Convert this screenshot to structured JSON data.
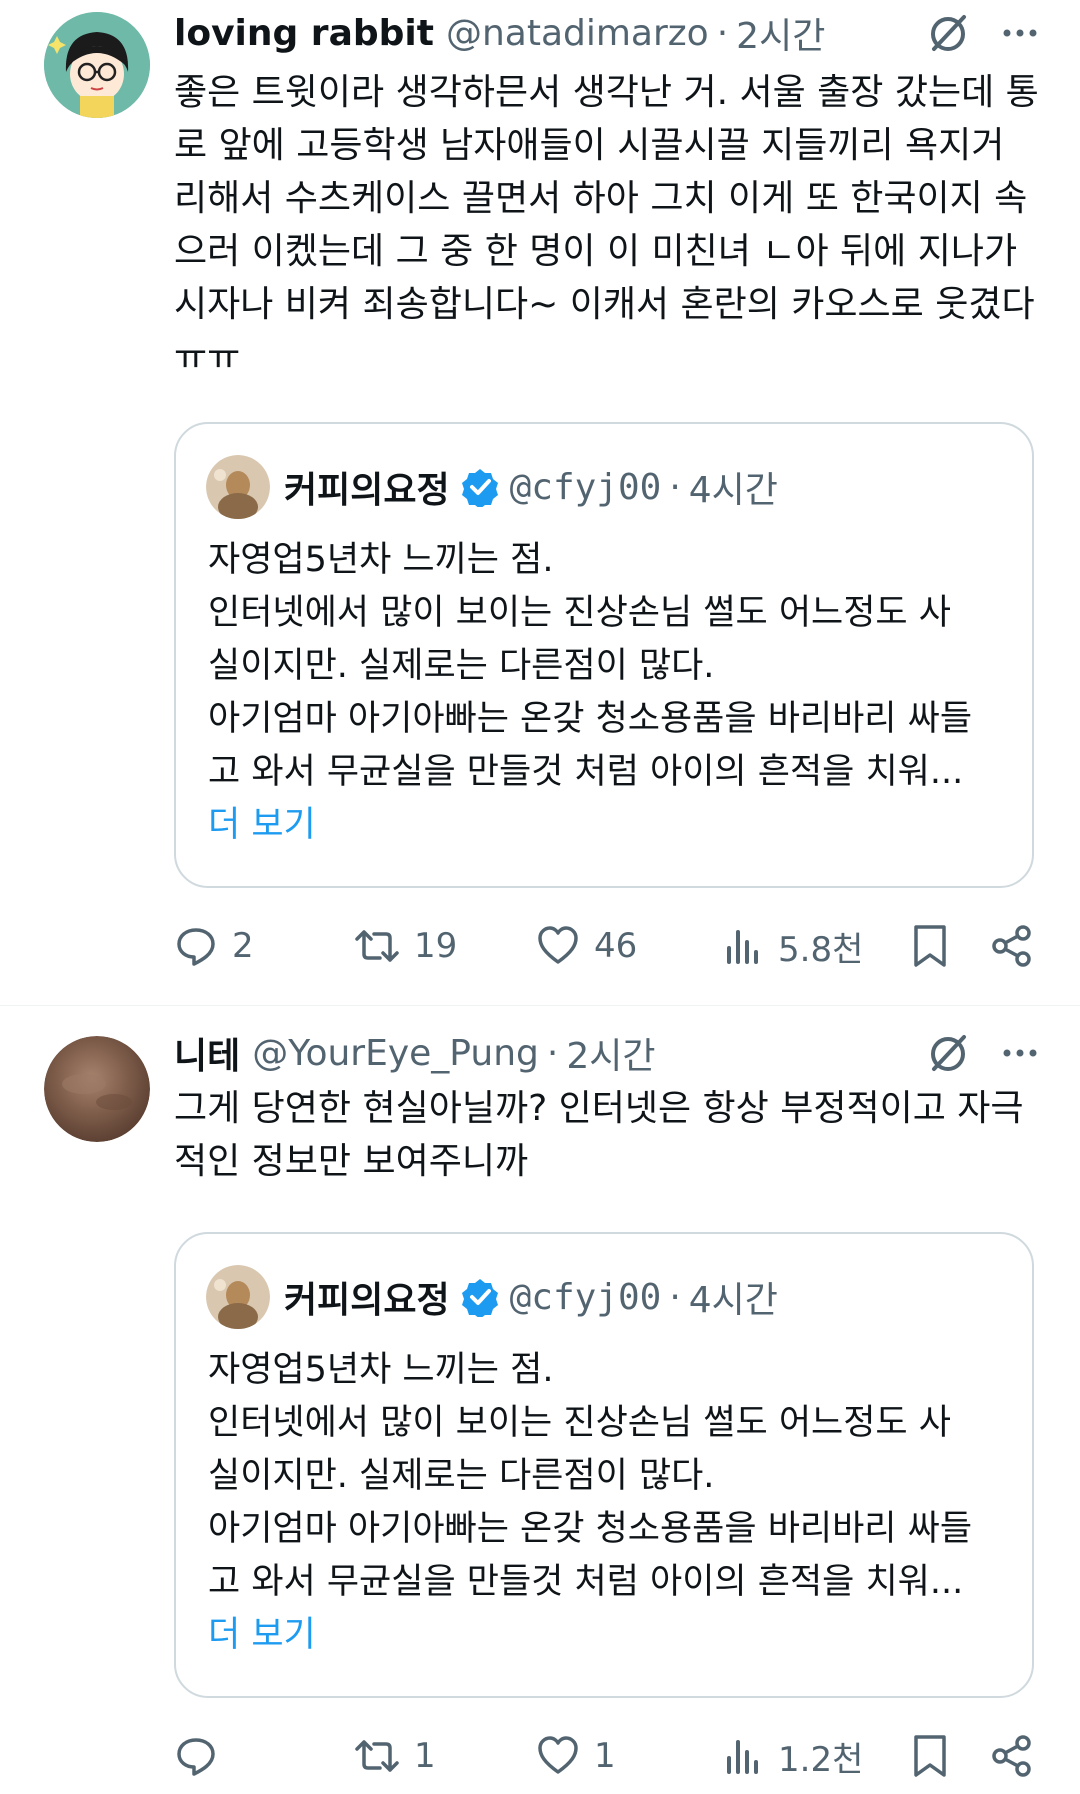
{
  "tweets": [
    {
      "name": "loving rabbit",
      "handle": "@natadimarzo",
      "separator": "·",
      "time": "2시간",
      "lines": [
        "좋은 트윗이라 생각하믄서 생각난 거. 서울 출장 갔는데 통",
        "로 앞에 고등학생 남자애들이 시끌시끌 지들끼리 욕지거",
        "리해서 수츠케이스 끌면서 하아 그치 이게 또 한국이지 속",
        "으러 이켔는데 그 중 한 명이 이 미친녀 ㄴ아  뒤에 지나가",
        "시자나 비켜 죄송합니다~ 이캐서 혼란의 카오스로 웃겼다",
        "ㅠㅠ"
      ],
      "quote": {
        "name": "커피의요정",
        "handle": "@cfyj00",
        "separator": "·",
        "time": "4시간",
        "lines": [
          "자영업5년차 느끼는 점.",
          "인터넷에서 많이 보이는 진상손님 썰도 어느정도 사",
          "실이지만. 실제로는 다른점이 많다.",
          "아기엄마 아기아빠는 온갖 청소용품을 바리바리 싸들",
          "고 와서 무균실을 만들것 처럼 아이의 흔적을 치워..."
        ],
        "more": "더 보기"
      },
      "actions": {
        "replies": "2",
        "retweets": "19",
        "likes": "46",
        "views": "5.8천"
      }
    },
    {
      "name": "니테",
      "handle": "@YourEye_Pung",
      "separator": "·",
      "time": "2시간",
      "lines": [
        "그게 당연한 현실아닐까? 인터넷은 항상 부정적이고 자극",
        "적인 정보만 보여주니까"
      ],
      "quote": {
        "name": "커피의요정",
        "handle": "@cfyj00",
        "separator": "·",
        "time": "4시간",
        "lines": [
          "자영업5년차 느끼는 점.",
          "인터넷에서 많이 보이는 진상손님 썰도 어느정도 사",
          "실이지만. 실제로는 다른점이 많다.",
          "아기엄마 아기아빠는 온갖 청소용품을 바리바리 싸들",
          "고 와서 무균실을 만들것 처럼 아이의 흔적을 치워..."
        ],
        "more": "더 보기"
      },
      "actions": {
        "replies": "",
        "retweets": "1",
        "likes": "1",
        "views": "1.2천"
      }
    }
  ],
  "icons": {
    "grok": "grok-icon",
    "more": "more-options-icon",
    "reply": "reply-icon",
    "retweet": "retweet-icon",
    "like": "heart-icon",
    "views": "views-icon",
    "bookmark": "bookmark-icon",
    "share": "share-icon",
    "verified": "verified-badge-icon"
  },
  "colors": {
    "text": "#0f1419",
    "secondary": "#536471",
    "link": "#1d9bf0",
    "verified": "#1d9bf0",
    "border": "#cfd9de"
  }
}
